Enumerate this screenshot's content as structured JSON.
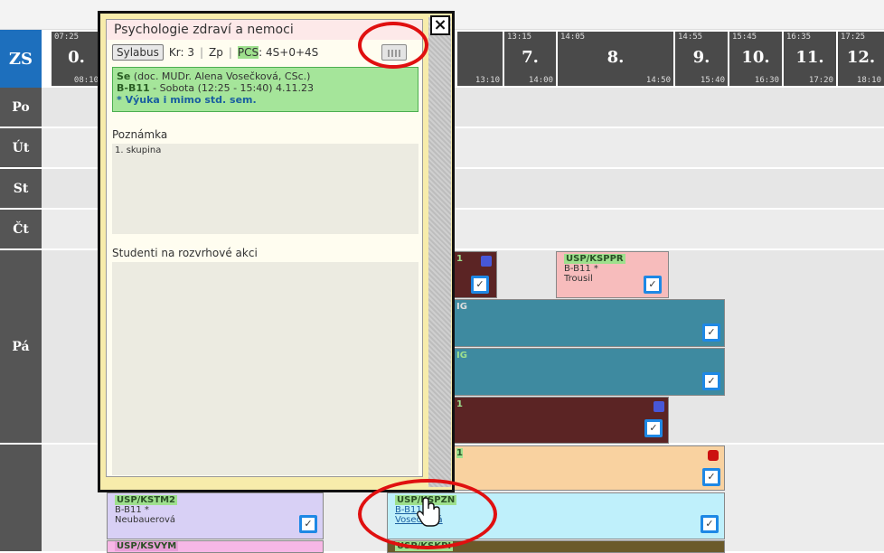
{
  "semester": "ZS",
  "slots": [
    {
      "start": "07:25",
      "end": "08:10",
      "num": "0."
    },
    {
      "start": "13:15",
      "end": "14:00",
      "num": "7."
    },
    {
      "start": "14:05",
      "end": "14:50",
      "num": "8."
    },
    {
      "start": "14:55",
      "end": "15:40",
      "num": "9."
    },
    {
      "start": "15:45",
      "end": "16:30",
      "num": "10."
    },
    {
      "start": "16:35",
      "end": "17:20",
      "num": "11."
    },
    {
      "start": "17:25",
      "end": "18:10",
      "num": "12."
    }
  ],
  "slot_partial_end": "13:10",
  "days": [
    "Po",
    "Út",
    "St",
    "Čt",
    "Pá"
  ],
  "events": {
    "ksppr": {
      "code": "USP/KSPPR",
      "room": "B-B11 *",
      "teacher": "Trousil",
      "color": "#f7bcbc"
    },
    "kstm2": {
      "code": "USP/KSTM2",
      "room": "B-B11 *",
      "teacher": "Neubauerová",
      "color": "#d8d0f5"
    },
    "kspzn": {
      "code": "USP/KSPZN",
      "room": "B-B11",
      "teacher": "Vosečková",
      "color": "#bff0fb"
    },
    "ksvym": {
      "code": "USP/KSVYM"
    },
    "kskpi": {
      "code": "USP/KSKPI"
    },
    "frag1": "1",
    "frag_ig1": "IG",
    "frag_ig2": "IG",
    "frag2": "1",
    "frag3": "1"
  },
  "popup": {
    "title": "Psychologie zdraví a nemoci",
    "syllabus_button": "Sylabus",
    "credits": "Kr: 3",
    "completion": "Zp",
    "pcs_label": "PCS",
    "pcs_value": ": 4S+0+4S",
    "sep": "|",
    "type": "Se",
    "teacher": "(doc. MUDr. Alena Vosečková, CSc.)",
    "room": "B-B11",
    "when": " - Sobota (12:25 - 15:40) 4.11.23",
    "note_line": "* Výuka i mimo std. sem.",
    "note_label": "Poznámka",
    "note_text": "1. skupina",
    "students_label": "Studenti na rozvrhové akci"
  },
  "colors": {
    "header_blue": "#1d6fbd",
    "slot_dark": "#4a4a4a",
    "teal": "#3e8aa0",
    "maroon": "#5b2424",
    "peach": "#f9d2a0",
    "annotation_red": "#e01010"
  }
}
